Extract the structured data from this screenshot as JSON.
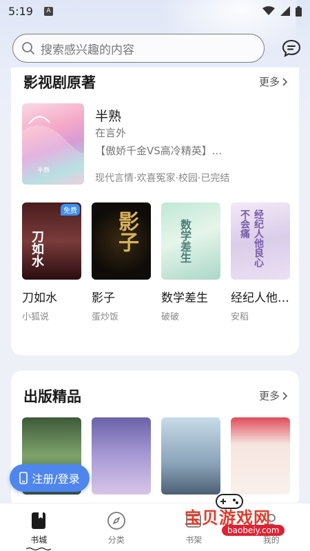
{
  "status": {
    "time": "5:19",
    "indicator": "A"
  },
  "search": {
    "placeholder": "搜索感兴趣的内容",
    "icon": "search-icon"
  },
  "section1": {
    "title": "影视剧原著",
    "more": "更多",
    "featured": {
      "title": "半熟",
      "author": "在言外",
      "desc": "【傲娇千金VS高冷精英】...",
      "tags": "现代言情·欢喜冤家·校园·已完结"
    },
    "books": [
      {
        "title": "刀如水",
        "author": "小狐说",
        "badge": "免费",
        "cover_text": "刀如水"
      },
      {
        "title": "影子",
        "author": "蛋炒饭",
        "cover_text": "影子"
      },
      {
        "title": "数学差生",
        "author": "破破",
        "cover_text": "数学差生"
      },
      {
        "title": "经纪人他良心不会...",
        "author": "安稻",
        "cover_text": "经纪人他良心不会痛"
      }
    ]
  },
  "section2": {
    "title": "出版精品",
    "more": "更多"
  },
  "login_button": "注册/登录",
  "tabs": [
    {
      "label": "书城",
      "icon": "book-icon"
    },
    {
      "label": "分类",
      "icon": "compass-icon"
    },
    {
      "label": "书架",
      "icon": "bookshelf-icon"
    },
    {
      "label": "我的",
      "icon": "profile-icon"
    }
  ],
  "watermark": {
    "main": "宝贝游戏网",
    "url": "baobeiy.com"
  }
}
